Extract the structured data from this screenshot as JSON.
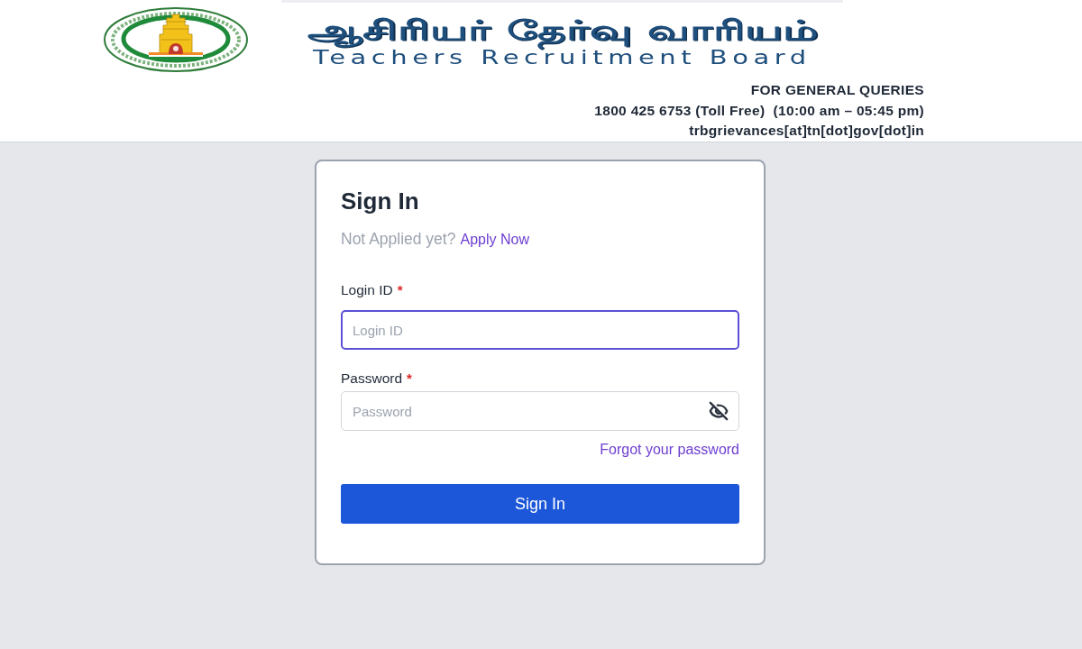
{
  "header": {
    "title_tamil": "ஆசிரியர் தேர்வு வாரியம்",
    "title_english": "Teachers Recruitment Board",
    "contact_lines": [
      "FOR GENERAL QUERIES",
      "1800 425 6753 (Toll Free)  (10:00 am – 05:45 pm)",
      "trbgrievances[at]tn[dot]gov[dot]in"
    ]
  },
  "signin": {
    "title": "Sign In",
    "prompt": "Not Applied yet?",
    "apply_link": "Apply Now",
    "fields": [
      {
        "kind": "text",
        "label": "Login ID",
        "required_mark": "*",
        "placeholder": "Login ID",
        "focused": true
      },
      {
        "kind": "password",
        "label": "Password",
        "required_mark": "*",
        "placeholder": "Password",
        "focused": false
      }
    ],
    "forgot_link": "Forgot your password",
    "submit": "Sign In"
  }
}
